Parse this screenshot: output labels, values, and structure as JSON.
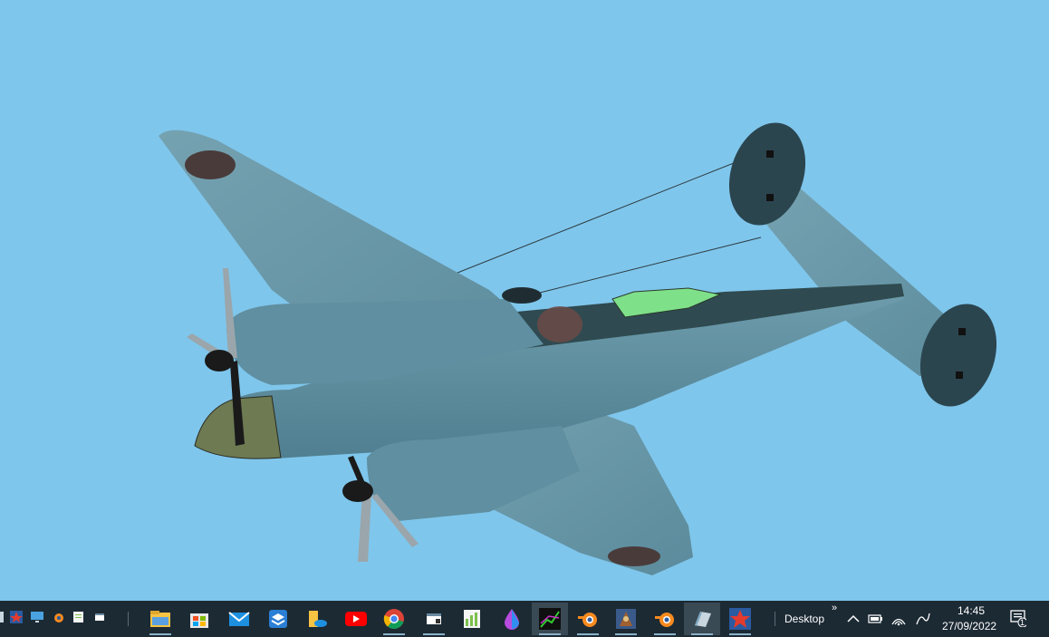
{
  "taskbar": {
    "quick_launch": [
      {
        "name": "quicklaunch-star-app-icon"
      },
      {
        "name": "quicklaunch-monitor-icon"
      },
      {
        "name": "quicklaunch-blender-icon"
      },
      {
        "name": "quicklaunch-notepad-icon"
      },
      {
        "name": "quicklaunch-window-icon"
      }
    ],
    "pinned_apps": [
      {
        "name": "file-explorer-icon",
        "color": "#f6c343"
      },
      {
        "name": "microsoft-store-icon",
        "color": "#4f8cf2"
      },
      {
        "name": "mail-icon",
        "color": "#1e90e0"
      },
      {
        "name": "stack-app-icon",
        "color": "#2b7fd4"
      },
      {
        "name": "onedrive-folder-icon",
        "color": "#f6c343"
      },
      {
        "name": "youtube-icon",
        "color": "#ff0000"
      },
      {
        "name": "chrome-icon",
        "color": "#34a853"
      },
      {
        "name": "window-app-icon",
        "color": "#ffffff"
      },
      {
        "name": "notepad-plus-icon",
        "color": "#7cc04b"
      },
      {
        "name": "paint-drop-icon",
        "color": "#b84ce0"
      },
      {
        "name": "graph-app-icon",
        "color": "#33cc33"
      },
      {
        "name": "blender-icon",
        "color": "#f58a1f"
      },
      {
        "name": "game-app-icon",
        "color": "#a06030"
      },
      {
        "name": "blender-icon-2",
        "color": "#f58a1f"
      },
      {
        "name": "editor-app-icon",
        "color": "#c8d6e0"
      },
      {
        "name": "star-sim-icon",
        "color": "#e33b2e"
      }
    ],
    "desktop_toolbar_label": "Desktop",
    "desktop_chevron": "»",
    "clock_time": "14:45",
    "clock_date": "27/09/2022",
    "notification_count": "1"
  },
  "scene": {
    "sky_color": "#7fc6ec",
    "aircraft_color": "#5f8fa0",
    "roundel_color": "#4a3b3b"
  }
}
